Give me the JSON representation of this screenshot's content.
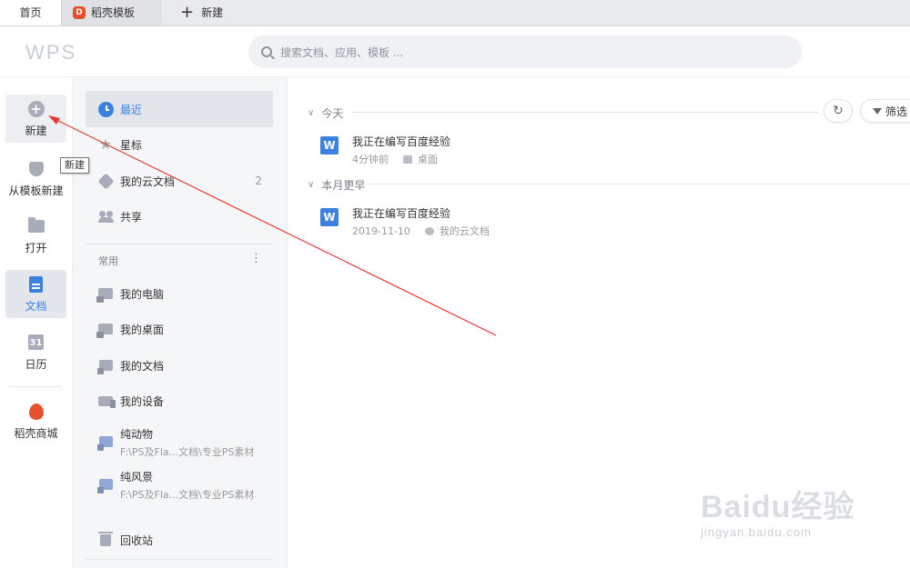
{
  "tabs": [
    {
      "label": "首页"
    },
    {
      "label": "稻壳模板",
      "icon": "docer-icon"
    },
    {
      "label": "新建",
      "icon": "plus-icon"
    }
  ],
  "header": {
    "logo": "WPS",
    "search_placeholder": "搜索文档、应用、模板 ..."
  },
  "rail": {
    "items": [
      {
        "label": "新建",
        "icon": "circle-plus-icon"
      },
      {
        "label": "从模板新建",
        "icon": "template-icon"
      },
      {
        "label": "打开",
        "icon": "folder-icon"
      },
      {
        "label": "文档",
        "icon": "document-icon"
      },
      {
        "label": "日历",
        "icon": "calendar-icon",
        "glyph": "31"
      },
      {
        "label": "稻壳商城",
        "icon": "docer-store-icon"
      }
    ],
    "tooltip": "新建"
  },
  "nav": {
    "primary": [
      {
        "label": "最近",
        "icon": "clock-icon"
      },
      {
        "label": "星标",
        "icon": "star-icon"
      },
      {
        "label": "我的云文档",
        "icon": "cloud-doc-icon",
        "count": "2"
      },
      {
        "label": "共享",
        "icon": "share-icon"
      }
    ],
    "section_label": "常用",
    "section_more": "⋮",
    "common": [
      {
        "label": "我的电脑",
        "icon": "computer-icon"
      },
      {
        "label": "我的桌面",
        "icon": "desktop-icon"
      },
      {
        "label": "我的文档",
        "icon": "my-docs-icon"
      },
      {
        "label": "我的设备",
        "icon": "device-icon"
      },
      {
        "label": "纯动物",
        "path": "F:\\PS及Fla...文档\\专业PS素材",
        "icon": "folder-shortcut-icon"
      },
      {
        "label": "纯风景",
        "path": "F:\\PS及Fla...文档\\专业PS素材",
        "icon": "folder-shortcut-icon"
      }
    ],
    "trash": "回收站"
  },
  "main": {
    "refresh_icon": "refresh-icon",
    "filter_label": "筛选",
    "groups": [
      {
        "title": "今天",
        "files": [
          {
            "name": "我正在编写百度经验",
            "time": "4分钟前",
            "location": "桌面"
          }
        ]
      },
      {
        "title": "本月更早",
        "files": [
          {
            "name": "我正在编写百度经验",
            "time": "2019-11-10",
            "location": "我的云文档"
          }
        ]
      }
    ]
  },
  "watermark": {
    "main": "Baidu经验",
    "sub": "jingyan.baidu.com"
  },
  "colors": {
    "accent": "#3b82e0",
    "arrow": "#e53935",
    "docer": "#e8502a"
  }
}
